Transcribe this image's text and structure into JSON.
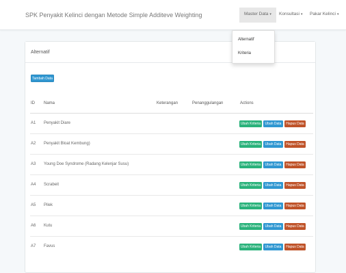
{
  "navbar": {
    "brand": "SPK Penyakit Kelinci dengan Metode Simple Additeve Weighting",
    "menu": [
      {
        "label": "Master Data"
      },
      {
        "label": "Konsultasi"
      },
      {
        "label": "Pakar Kelinci"
      }
    ],
    "dropdown": [
      "Alternatif",
      "Kriteria"
    ]
  },
  "panel": {
    "title": "Alternatif",
    "add_button": "Tambah Data",
    "columns": [
      "ID",
      "Nama",
      "Keterangan",
      "Penanggulangan",
      "Actions"
    ],
    "rows": [
      {
        "id": "A1",
        "nama": "Penyakit Diare"
      },
      {
        "id": "A2",
        "nama": "Penyakit Bloat Kembung)"
      },
      {
        "id": "A3",
        "nama": "Young Doe Syndrome (Radang Kelenjar Susu)"
      },
      {
        "id": "A4",
        "nama": "Scrabeit"
      },
      {
        "id": "A5",
        "nama": "Pilek"
      },
      {
        "id": "A6",
        "nama": "Kutu"
      },
      {
        "id": "A7",
        "nama": "Favus"
      }
    ],
    "actions": {
      "edit_criteria": "Ubah Kriteria",
      "edit": "Ubah Data",
      "delete": "Hapus Data"
    }
  },
  "colors": {
    "primary": "#3097d1",
    "success": "#2ab27b",
    "danger": "#bf5329"
  }
}
